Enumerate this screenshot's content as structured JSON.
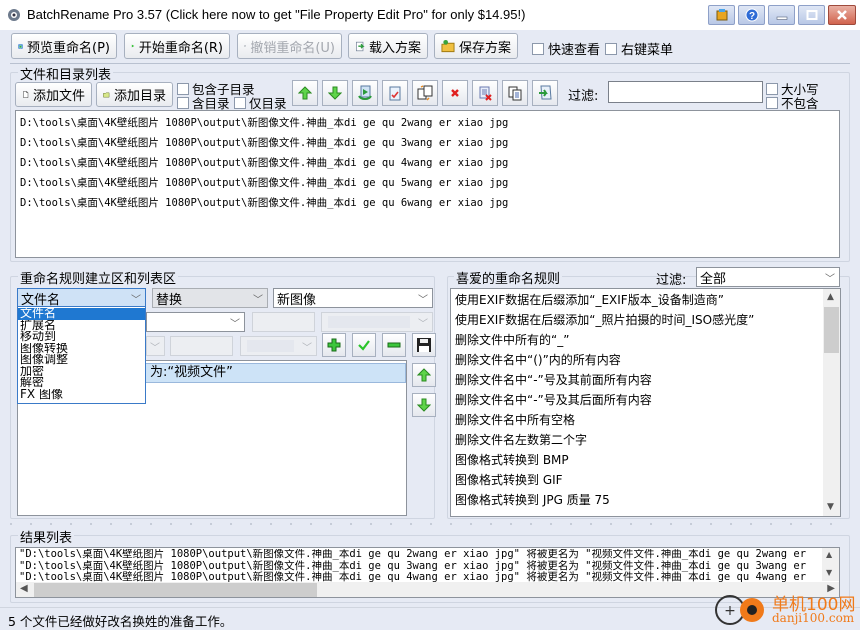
{
  "window": {
    "title": "BatchRename Pro 3.57  (Click here now to get \"File Property Edit Pro\" for only $14.95!)",
    "controls": [
      "app-icon",
      "help",
      "minimize",
      "maximize",
      "close"
    ]
  },
  "toolbar": {
    "preview_label": "预览重命名(P)",
    "start_label": "开始重命名(R)",
    "undo_label": "撤销重命名(U)",
    "load_label": "载入方案",
    "save_label": "保存方案",
    "quick_view_label": "快速查看",
    "context_menu_label": "右键菜单"
  },
  "files_section": {
    "legend": "文件和目录列表",
    "add_file_label": "添加文件",
    "add_folder_label": "添加目录",
    "include_subdirs_label": "包含子目录",
    "include_dirs_label": "含目录",
    "dirs_only_label": "仅目录",
    "filter_label": "过滤:",
    "filter_value": "",
    "case_label": "大小写",
    "exclude_label": "不包含",
    "icon_buttons": [
      "move-up",
      "move-down",
      "refresh",
      "check",
      "swap",
      "delete",
      "delete-all",
      "copy",
      "import"
    ],
    "files": [
      "D:\\tools\\桌面\\4K壁纸图片 1080P\\output\\新图像文件.神曲_本di  ge qu 2wang er xiao jpg",
      "D:\\tools\\桌面\\4K壁纸图片 1080P\\output\\新图像文件.神曲_本di  ge qu 3wang er xiao jpg",
      "D:\\tools\\桌面\\4K壁纸图片 1080P\\output\\新图像文件.神曲_本di  ge qu 4wang er xiao jpg",
      "D:\\tools\\桌面\\4K壁纸图片 1080P\\output\\新图像文件.神曲_本di  ge qu 5wang er xiao jpg",
      "D:\\tools\\桌面\\4K壁纸图片 1080P\\output\\新图像文件.神曲_本di  ge qu 6wang er xiao jpg"
    ]
  },
  "rules_section": {
    "legend": "重命名规则建立区和列表区",
    "target_combo": "文件名",
    "action_combo": "替换",
    "value_combo": "新图像",
    "dropdown_options": [
      "文件名",
      "扩展名",
      "移动到",
      "图像转换",
      "图像调整",
      "加密",
      "解密",
      "FX 图像"
    ],
    "selected_option_index": 0,
    "rule_list": [
      "为:“视频文件”"
    ]
  },
  "favorites_section": {
    "legend": "喜爱的重命名规则",
    "filter_label": "过滤:",
    "filter_value": "全部",
    "items": [
      "使用EXIF数据在后缀添加“_EXIF版本_设备制造商”",
      "使用EXIF数据在后缀添加“_照片拍摄的时间_ISO感光度”",
      "删除文件中所有的“_”",
      "删除文件名中“()”内的所有内容",
      "删除文件名中“-”号及其前面所有内容",
      "删除文件名中“-”号及其后面所有内容",
      "删除文件名中所有空格",
      "删除文件名左数第二个字",
      "图像格式转换到 BMP",
      "图像格式转换到 GIF",
      "图像格式转换到 JPG 质量 75"
    ]
  },
  "results_section": {
    "legend": "结果列表",
    "rows": [
      "\"D:\\tools\\桌面\\4K壁纸图片 1080P\\output\\新图像文件.神曲_本di  ge qu 2wang er xiao jpg\" 将被更名为 \"视频文件文件.神曲_本di  ge qu 2wang er",
      "\"D:\\tools\\桌面\\4K壁纸图片 1080P\\output\\新图像文件.神曲_本di  ge qu 3wang er xiao jpg\" 将被更名为 \"视频文件文件.神曲_本di  ge qu 3wang er",
      "\"D:\\tools\\桌面\\4K壁纸图片 1080P\\output\\新图像文件.神曲_本di  ge qu 4wang er xiao jpg\" 将被更名为 \"视频文件文件.神曲_本di  ge qu 4wang er"
    ]
  },
  "status": {
    "text": "5 个文件已经做好改名换姓的准备工作。"
  },
  "watermark": {
    "cn": "单机100网",
    "url": "danji100.com"
  }
}
